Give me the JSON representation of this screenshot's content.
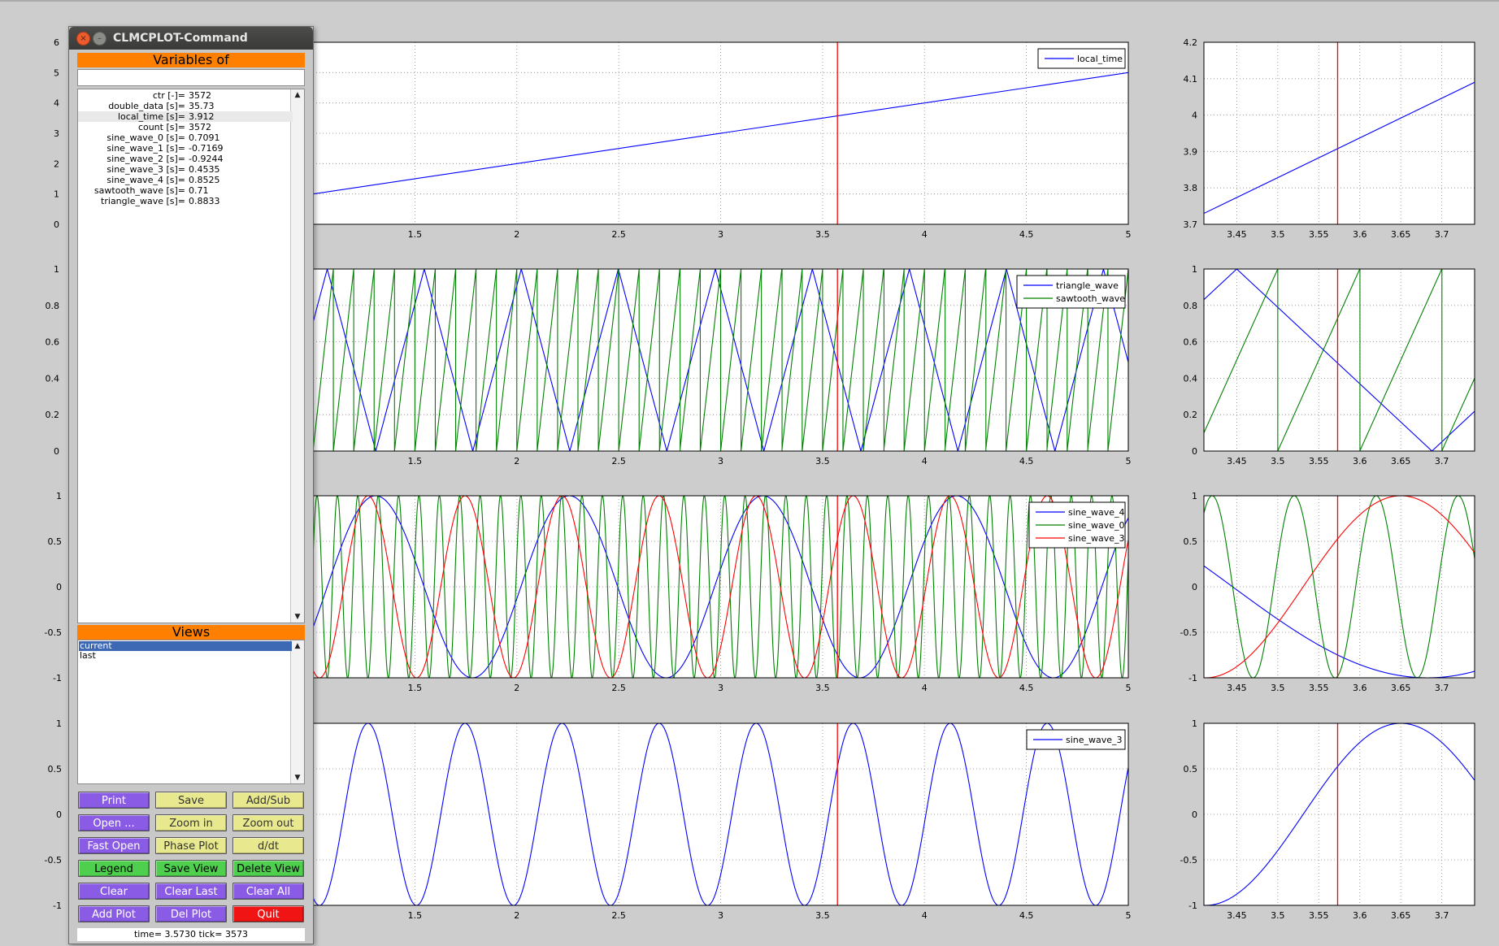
{
  "window": {
    "title": "CLMCPLOT-Command"
  },
  "variables": {
    "header": "Variables of",
    "filter_value": "",
    "items": [
      {
        "name": "ctr [-]=",
        "value": "3572"
      },
      {
        "name": "double_data [s]=",
        "value": "35.73"
      },
      {
        "name": "local_time [s]=",
        "value": "3.912"
      },
      {
        "name": "count [s]=",
        "value": "3572"
      },
      {
        "name": "sine_wave_0 [s]=",
        "value": "0.7091"
      },
      {
        "name": "sine_wave_1 [s]=",
        "value": "-0.7169"
      },
      {
        "name": "sine_wave_2 [s]=",
        "value": "-0.9244"
      },
      {
        "name": "sine_wave_3 [s]=",
        "value": "0.4535"
      },
      {
        "name": "sine_wave_4 [s]=",
        "value": "0.8525"
      },
      {
        "name": "sawtooth_wave [s]=",
        "value": "0.71"
      },
      {
        "name": "triangle_wave [s]=",
        "value": "0.8833"
      }
    ],
    "highlighted_index": 2
  },
  "views": {
    "header": "Views",
    "items": [
      "current",
      "last"
    ],
    "selected_index": 0
  },
  "buttons": [
    {
      "label": "Print",
      "style": "purple"
    },
    {
      "label": "Save",
      "style": "yellow"
    },
    {
      "label": "Add/Sub",
      "style": "yellow"
    },
    {
      "label": "Open ...",
      "style": "purple"
    },
    {
      "label": "Zoom in",
      "style": "yellow"
    },
    {
      "label": "Zoom out",
      "style": "yellow"
    },
    {
      "label": "Fast Open",
      "style": "purple"
    },
    {
      "label": "Phase Plot",
      "style": "yellow"
    },
    {
      "label": "d/dt",
      "style": "yellow"
    },
    {
      "label": "Legend",
      "style": "green"
    },
    {
      "label": "Save View",
      "style": "green"
    },
    {
      "label": "Delete View",
      "style": "green"
    },
    {
      "label": "Clear",
      "style": "purple"
    },
    {
      "label": "Clear Last",
      "style": "purple"
    },
    {
      "label": "Clear All",
      "style": "purple"
    },
    {
      "label": "Add Plot",
      "style": "purple"
    },
    {
      "label": "Del Plot",
      "style": "purple"
    },
    {
      "label": "Quit",
      "style": "red"
    }
  ],
  "status": {
    "text": "time= 3.5730  tick= 3573"
  },
  "cursor_time": 3.573,
  "colors": {
    "blue": "#0000ff",
    "green": "#008000",
    "red": "#ff0000",
    "orange_header": "#ff8000"
  },
  "chart_data": [
    {
      "type": "line",
      "panel": "main",
      "xlim": [
        1.0,
        5.0
      ],
      "ylim": [
        0,
        6
      ],
      "xticks": [
        "1.5",
        "2",
        "2.5",
        "3",
        "3.5",
        "4",
        "4.5",
        "5"
      ],
      "yticks": [
        "0",
        "1",
        "2",
        "3",
        "4",
        "5",
        "6"
      ],
      "series": [
        {
          "name": "local_time",
          "color": "blue",
          "kind": "linear",
          "x": [
            1.0,
            5.0
          ],
          "y": [
            1.0,
            5.0
          ]
        }
      ],
      "legend": "top-right",
      "grid": true
    },
    {
      "type": "line",
      "panel": "zoom",
      "xlim": [
        3.41,
        3.74
      ],
      "ylim": [
        3.7,
        4.2
      ],
      "xticks": [
        "3.45",
        "3.5",
        "3.55",
        "3.6",
        "3.65",
        "3.7"
      ],
      "yticks": [
        "3.7",
        "3.8",
        "3.9",
        "4",
        "4.1",
        "4.2"
      ],
      "series": [
        {
          "name": "local_time",
          "color": "blue",
          "kind": "linear",
          "x": [
            3.41,
            3.74
          ],
          "y": [
            3.73,
            4.09
          ]
        }
      ],
      "grid": true
    },
    {
      "type": "line",
      "panel": "main",
      "xlim": [
        1.0,
        5.0
      ],
      "ylim": [
        0,
        1
      ],
      "xticks": [
        "1.5",
        "2",
        "2.5",
        "3",
        "3.5",
        "4",
        "4.5",
        "5"
      ],
      "yticks": [
        "0",
        "0.2",
        "0.4",
        "0.6",
        "0.8",
        "1"
      ],
      "series": [
        {
          "name": "triangle_wave",
          "color": "blue",
          "kind": "triangle",
          "period": 0.476,
          "phase": 1.07
        },
        {
          "name": "sawtooth_wave",
          "color": "green",
          "kind": "sawtooth",
          "period": 0.1,
          "phase": 3.4
        }
      ],
      "legend": "top-right",
      "grid": true
    },
    {
      "type": "line",
      "panel": "zoom",
      "xlim": [
        3.41,
        3.74
      ],
      "ylim": [
        0,
        1
      ],
      "xticks": [
        "3.45",
        "3.5",
        "3.55",
        "3.6",
        "3.65",
        "3.7"
      ],
      "yticks": [
        "0",
        "0.2",
        "0.4",
        "0.6",
        "0.8",
        "1"
      ],
      "series": [
        {
          "name": "triangle_wave",
          "color": "blue",
          "kind": "triangle",
          "period": 0.476,
          "phase": 1.07
        },
        {
          "name": "sawtooth_wave",
          "color": "green",
          "kind": "sawtooth",
          "period": 0.1,
          "phase": 3.4
        }
      ],
      "grid": true
    },
    {
      "type": "line",
      "panel": "main",
      "xlim": [
        1.0,
        5.0
      ],
      "ylim": [
        -1,
        1
      ],
      "xticks": [
        "1.5",
        "2",
        "2.5",
        "3",
        "3.5",
        "4",
        "4.5",
        "5"
      ],
      "yticks": [
        "-1",
        "-0.5",
        "0",
        "0.5",
        "1"
      ],
      "series": [
        {
          "name": "sine_wave_4",
          "color": "blue",
          "kind": "sine",
          "period": 0.95,
          "phase": 1.07
        },
        {
          "name": "sine_wave_0",
          "color": "green",
          "kind": "sine",
          "period": 0.1,
          "phase": 3.595
        },
        {
          "name": "sine_wave_3",
          "color": "red",
          "kind": "sine",
          "period": 0.476,
          "phase": 3.531
        }
      ],
      "legend": "top-right",
      "grid": true
    },
    {
      "type": "line",
      "panel": "zoom",
      "xlim": [
        3.41,
        3.74
      ],
      "ylim": [
        -1,
        1
      ],
      "xticks": [
        "3.45",
        "3.5",
        "3.55",
        "3.6",
        "3.65",
        "3.7"
      ],
      "yticks": [
        "-1",
        "-0.5",
        "0",
        "0.5",
        "1"
      ],
      "series": [
        {
          "name": "sine_wave_4",
          "color": "blue",
          "kind": "sine",
          "period": 0.95,
          "phase": 1.07
        },
        {
          "name": "sine_wave_0",
          "color": "green",
          "kind": "sine",
          "period": 0.1,
          "phase": 3.595
        },
        {
          "name": "sine_wave_3",
          "color": "red",
          "kind": "sine",
          "period": 0.476,
          "phase": 3.531
        }
      ],
      "grid": true
    },
    {
      "type": "line",
      "panel": "main",
      "xlim": [
        1.0,
        5.0
      ],
      "ylim": [
        -1,
        1
      ],
      "xticks": [
        "1.5",
        "2",
        "2.5",
        "3",
        "3.5",
        "4",
        "4.5",
        "5"
      ],
      "yticks": [
        "-1",
        "-0.5",
        "0",
        "0.5",
        "1"
      ],
      "series": [
        {
          "name": "sine_wave_3",
          "color": "blue",
          "kind": "sine",
          "period": 0.476,
          "phase": 3.531
        }
      ],
      "legend": "top-right",
      "grid": true
    },
    {
      "type": "line",
      "panel": "zoom",
      "xlim": [
        3.41,
        3.74
      ],
      "ylim": [
        -1,
        1
      ],
      "xticks": [
        "3.45",
        "3.5",
        "3.55",
        "3.6",
        "3.65",
        "3.7"
      ],
      "yticks": [
        "-1",
        "-0.5",
        "0",
        "0.5",
        "1"
      ],
      "series": [
        {
          "name": "sine_wave_3",
          "color": "blue",
          "kind": "sine",
          "period": 0.476,
          "phase": 3.531
        }
      ],
      "grid": true
    }
  ]
}
